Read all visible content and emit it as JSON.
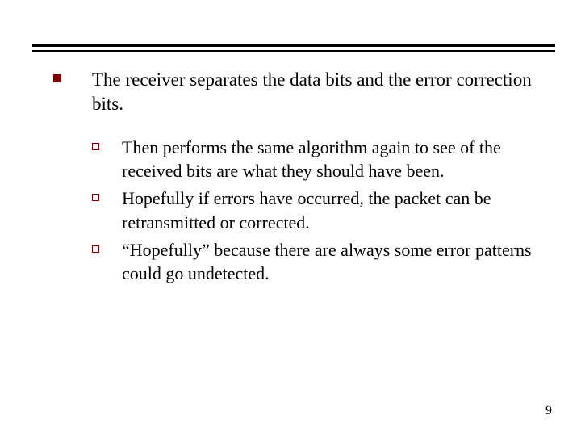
{
  "slide": {
    "main_point": "The receiver separates the data bits and the error correction bits.",
    "sub_points": {
      "p0": "Then performs the same algorithm again to see of the received bits are what they should have been.",
      "p1": "Hopefully if errors have occurred, the packet can be retransmitted or corrected.",
      "p2": "“Hopefully” because there are always some error patterns could go undetected."
    },
    "page_number": "9"
  },
  "colors": {
    "bullet": "#800000",
    "rule": "#000000"
  }
}
